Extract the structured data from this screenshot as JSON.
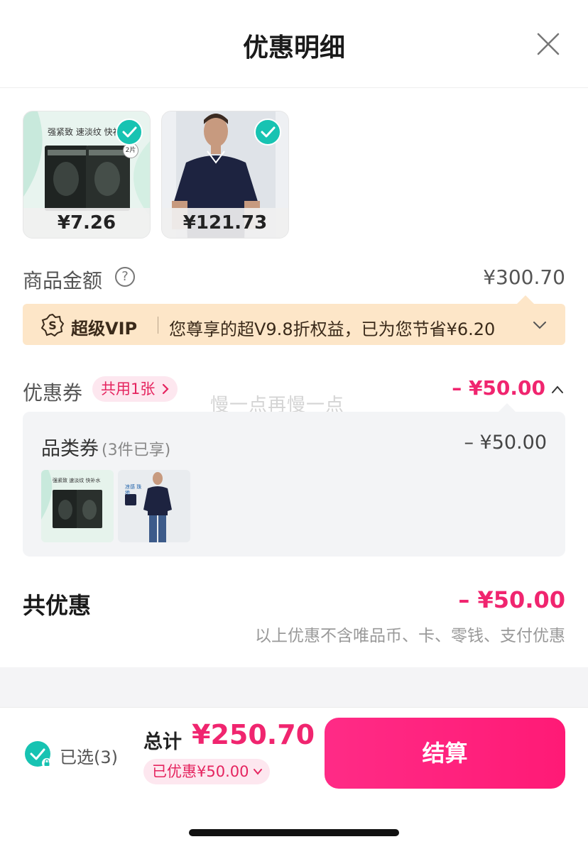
{
  "header": {
    "title": "优惠明细"
  },
  "products": [
    {
      "price": "¥7.26",
      "name": "face-mask",
      "thumb_text": "强紧致 速淡纹 快补水",
      "qty_badge": "2片"
    },
    {
      "price": "¥121.73",
      "name": "polo-shirt"
    }
  ],
  "amount": {
    "label": "商品金额",
    "value": "¥300.70"
  },
  "vip": {
    "brand": "超级VIP",
    "text": "您尊享的超V9.8折权益，已为您节省¥6.20"
  },
  "coupon": {
    "label": "优惠券",
    "tag": "共用1张",
    "value": "– ¥50.00",
    "watermark": "慢一点再慢一点",
    "detail": {
      "name": "品类券",
      "sub": "(3件已享)",
      "value": "– ¥50.00",
      "thumb_mask_text": "强紧致 速淡纹 快补水",
      "thumb_polo_text": "凉感 珠地"
    }
  },
  "total": {
    "label": "共优惠",
    "value": "– ¥50.00",
    "note": "以上优惠不含唯品币、卡、零钱、支付优惠"
  },
  "bottom": {
    "selected": "已选(3)",
    "sum_label": "总计",
    "sum_value": "¥250.70",
    "discount": "已优惠¥50.00",
    "pay": "结算"
  },
  "colors": {
    "accent": "#f0256f",
    "check": "#17c3b2",
    "vip_bg": "#fde6c8"
  }
}
